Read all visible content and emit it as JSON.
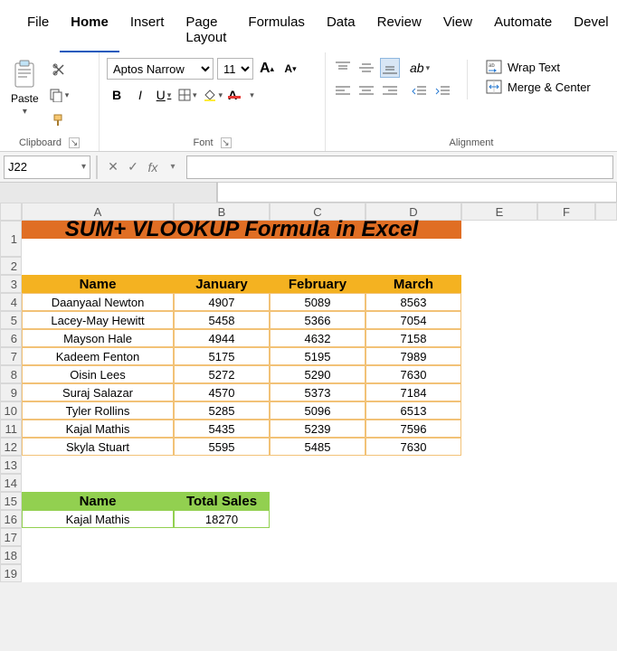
{
  "tabs": [
    "File",
    "Home",
    "Insert",
    "Page Layout",
    "Formulas",
    "Data",
    "Review",
    "View",
    "Automate",
    "Devel"
  ],
  "active_tab": "Home",
  "clipboard": {
    "paste": "Paste",
    "group": "Clipboard"
  },
  "font": {
    "name": "Aptos Narrow",
    "size": "11",
    "bold": "B",
    "italic": "I",
    "underline": "U",
    "group": "Font"
  },
  "alignment": {
    "wrap": "Wrap Text",
    "merge": "Merge & Center",
    "group": "Alignment"
  },
  "namebox": "J22",
  "formula": "",
  "cols": [
    "A",
    "B",
    "C",
    "D",
    "E",
    "F",
    ""
  ],
  "title": "SUM+ VLOOKUP Formula in Excel",
  "headers": [
    "Name",
    "January",
    "February",
    "March"
  ],
  "rows": [
    {
      "name": "Daanyaal Newton",
      "jan": "4907",
      "feb": "5089",
      "mar": "8563"
    },
    {
      "name": "Lacey-May Hewitt",
      "jan": "5458",
      "feb": "5366",
      "mar": "7054"
    },
    {
      "name": "Mayson Hale",
      "jan": "4944",
      "feb": "4632",
      "mar": "7158"
    },
    {
      "name": "Kadeem Fenton",
      "jan": "5175",
      "feb": "5195",
      "mar": "7989"
    },
    {
      "name": "Oisin Lees",
      "jan": "5272",
      "feb": "5290",
      "mar": "7630"
    },
    {
      "name": "Suraj Salazar",
      "jan": "4570",
      "feb": "5373",
      "mar": "7184"
    },
    {
      "name": "Tyler Rollins",
      "jan": "5285",
      "feb": "5096",
      "mar": "6513"
    },
    {
      "name": "Kajal Mathis",
      "jan": "5435",
      "feb": "5239",
      "mar": "7596"
    },
    {
      "name": "Skyla Stuart",
      "jan": "5595",
      "feb": "5485",
      "mar": "7630"
    }
  ],
  "green_headers": [
    "Name",
    "Total Sales"
  ],
  "green_row": {
    "name": "Kajal Mathis",
    "total": "18270"
  },
  "rownums": [
    "1",
    "2",
    "3",
    "4",
    "5",
    "6",
    "7",
    "8",
    "9",
    "10",
    "11",
    "12",
    "13",
    "14",
    "15",
    "16",
    "17",
    "18",
    "19"
  ]
}
